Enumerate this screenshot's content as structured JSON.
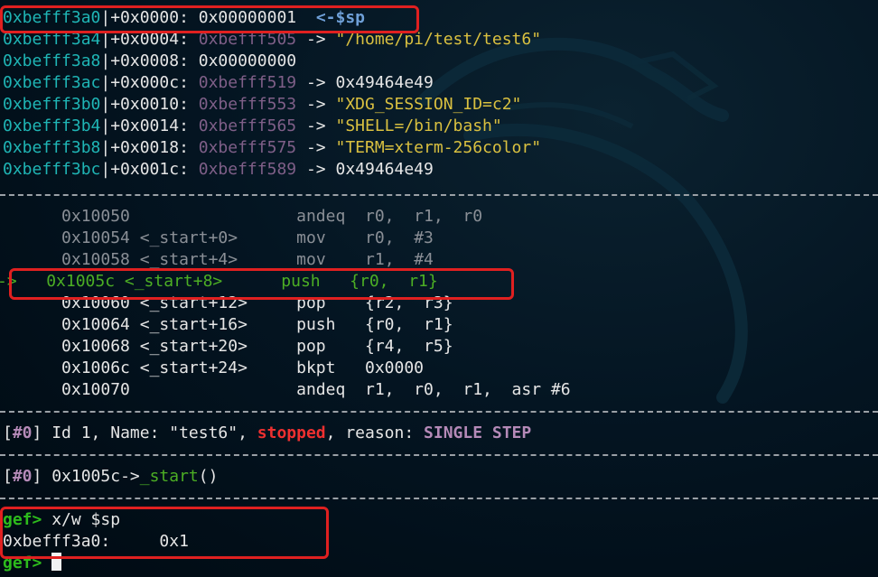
{
  "stack": [
    {
      "addr": "0xbefff3a0",
      "off": "|+0x0000: ",
      "val": "0x00000001",
      "arrow": "  ",
      "note": "<-$sp",
      "note_type": "sp"
    },
    {
      "addr": "0xbefff3a4",
      "off": "|+0x0004: ",
      "val": "0xbefff505",
      "arrow": " -> ",
      "note": "\"/home/pi/test/test6\"",
      "note_type": "str"
    },
    {
      "addr": "0xbefff3a8",
      "off": "|+0x0008: ",
      "val": "0x00000000",
      "arrow": "",
      "note": "",
      "note_type": "none"
    },
    {
      "addr": "0xbefff3ac",
      "off": "|+0x000c: ",
      "val": "0xbefff519",
      "arrow": " -> ",
      "note": "0x49464e49",
      "note_type": "plain"
    },
    {
      "addr": "0xbefff3b0",
      "off": "|+0x0010: ",
      "val": "0xbefff553",
      "arrow": " -> ",
      "note": "\"XDG_SESSION_ID=c2\"",
      "note_type": "str"
    },
    {
      "addr": "0xbefff3b4",
      "off": "|+0x0014: ",
      "val": "0xbefff565",
      "arrow": " -> ",
      "note": "\"SHELL=/bin/bash\"",
      "note_type": "str"
    },
    {
      "addr": "0xbefff3b8",
      "off": "|+0x0018: ",
      "val": "0xbefff575",
      "arrow": " -> ",
      "note": "\"TERM=xterm-256color\"",
      "note_type": "str"
    },
    {
      "addr": "0xbefff3bc",
      "off": "|+0x001c: ",
      "val": "0xbefff589",
      "arrow": " -> ",
      "note": "0x49464e49",
      "note_type": "plain"
    }
  ],
  "code": [
    {
      "prefix": "      ",
      "addr": "0x10050",
      "sym": "",
      "pad": "                 ",
      "op": "andeq",
      "args": "r0,  r1,  r0",
      "state": "past"
    },
    {
      "prefix": "      ",
      "addr": "0x10054",
      "sym": " <_start+0>",
      "pad": "      ",
      "op": "mov  ",
      "args": "r0,  #3",
      "state": "past"
    },
    {
      "prefix": "      ",
      "addr": "0x10058",
      "sym": " <_start+4>",
      "pad": "      ",
      "op": "mov  ",
      "args": "r1,  #4",
      "state": "past"
    },
    {
      "prefix": "->   ",
      "addr": "0x1005c",
      "sym": " <_start+8>",
      "pad": "      ",
      "op": "push ",
      "args": "{r0,  r1}",
      "state": "current"
    },
    {
      "prefix": "      ",
      "addr": "0x10060",
      "sym": " <_start+12>",
      "pad": "     ",
      "op": "pop  ",
      "args": "{r2,  r3}",
      "state": "next"
    },
    {
      "prefix": "      ",
      "addr": "0x10064",
      "sym": " <_start+16>",
      "pad": "     ",
      "op": "push ",
      "args": "{r0,  r1}",
      "state": "next"
    },
    {
      "prefix": "      ",
      "addr": "0x10068",
      "sym": " <_start+20>",
      "pad": "     ",
      "op": "pop  ",
      "args": "{r4,  r5}",
      "state": "next"
    },
    {
      "prefix": "      ",
      "addr": "0x1006c",
      "sym": " <_start+24>",
      "pad": "     ",
      "op": "bkpt ",
      "args": "0x0000",
      "state": "next"
    },
    {
      "prefix": "      ",
      "addr": "0x10070",
      "sym": "",
      "pad": "                 ",
      "op": "andeq",
      "args": "r1,  r0,  r1,  asr #6",
      "state": "next"
    }
  ],
  "thread": {
    "open": "[",
    "idx": "#0",
    "mid": "] Id 1, Name: \"test6\", ",
    "status": "stopped",
    "reason_label": ", reason: ",
    "reason": "SINGLE STEP"
  },
  "trace": {
    "open": "[",
    "idx": "#0",
    "mid": "] 0x1005c->",
    "func": "_start",
    "tail": "()"
  },
  "console": {
    "prompt": "gef>",
    "command": " x/w $sp",
    "result_addr": "0xbefff3a0:",
    "result_val": "     0x1",
    "prompt2": "gef>"
  }
}
